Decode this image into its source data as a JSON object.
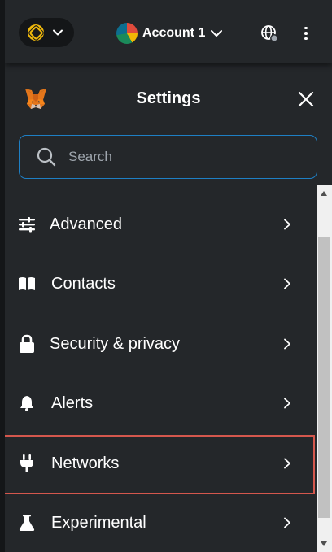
{
  "header": {
    "network_icon": "bnb-chain-icon",
    "account_name": "Account 1",
    "account_avatar": "account-avatar",
    "connections_icon": "globe-icon",
    "menu_icon": "kebab-menu-icon"
  },
  "settings": {
    "title": "Settings",
    "logo": "metamask-fox-icon",
    "close_icon": "close-icon"
  },
  "search": {
    "placeholder": "Search"
  },
  "menu": {
    "items": [
      {
        "label": "Advanced",
        "icon": "sliders-icon"
      },
      {
        "label": "Contacts",
        "icon": "book-icon"
      },
      {
        "label": "Security & privacy",
        "icon": "lock-icon"
      },
      {
        "label": "Alerts",
        "icon": "bell-icon"
      },
      {
        "label": "Networks",
        "icon": "plug-icon"
      },
      {
        "label": "Experimental",
        "icon": "flask-icon"
      }
    ],
    "highlighted": "Networks"
  },
  "colors": {
    "background": "#24272a",
    "search_border": "#1e7fc4",
    "highlight_border": "#d4574d",
    "network_pill": "#141618"
  }
}
